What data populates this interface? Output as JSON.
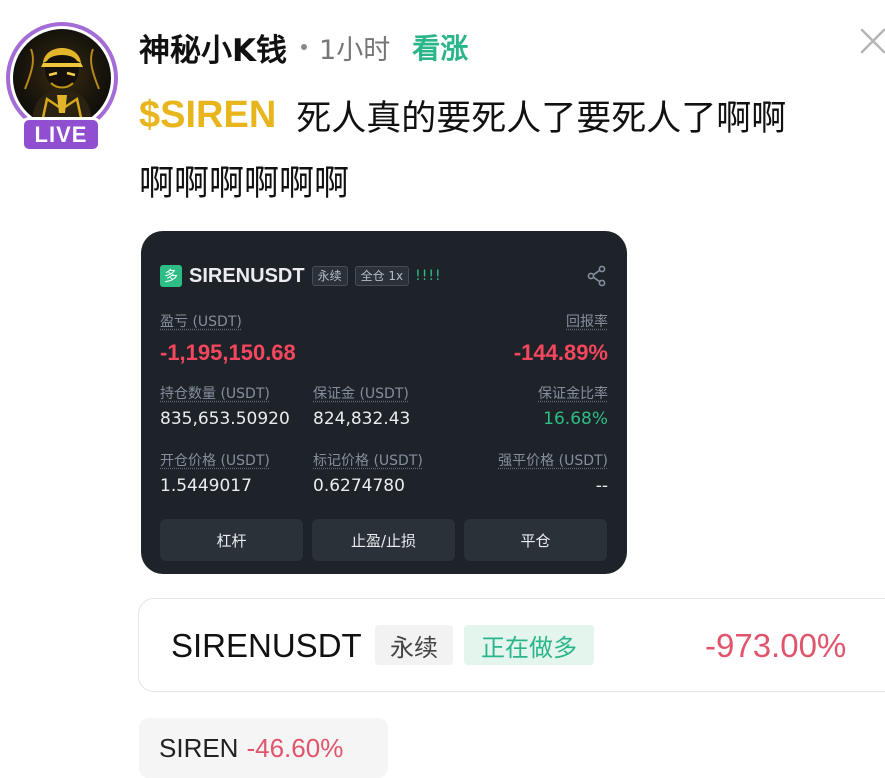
{
  "post": {
    "author": "神秘小K钱",
    "time": "1小时",
    "follow_label": "看涨",
    "live_badge": "LIVE",
    "ticker": "$SIREN",
    "text_line1": "死人真的要死人了要死人了啊啊",
    "text_line2": "啊啊啊啊啊啊"
  },
  "position_card": {
    "side_tag": "多",
    "symbol": "SIRENUSDT",
    "contract_tag": "永续",
    "margin_tag": "全仓 1x",
    "signal_bars": "!!!!",
    "pnl_label": "盈亏 (USDT)",
    "pnl_value": "-1,195,150.68",
    "roe_label": "回报率",
    "roe_value": "-144.89%",
    "size_label": "持仓数量 (USDT)",
    "size_value": "835,653.50920",
    "margin_label": "保证金 (USDT)",
    "margin_value": "824,832.43",
    "margin_ratio_label": "保证金比率",
    "margin_ratio_value": "16.68%",
    "entry_label": "开仓价格 (USDT)",
    "entry_value": "1.5449017",
    "mark_label": "标记价格 (USDT)",
    "mark_value": "0.6274780",
    "liq_label": "强平价格 (USDT)",
    "liq_value": "--",
    "buttons": [
      "杠杆",
      "止盈/止损",
      "平仓"
    ]
  },
  "trade_widget": {
    "symbol": "SIRENUSDT",
    "contract_tag": "永续",
    "direction": "正在做多",
    "pct": "-973.00%"
  },
  "ticker_chip": {
    "symbol": "SIREN",
    "pct": "-46.60%"
  },
  "icons": [
    "close-icon",
    "share-icon",
    "avatar-image"
  ],
  "colors": {
    "ticker": "#e8b51c",
    "follow": "#2bb58a",
    "live": "#8f4fd0",
    "card_bg": "#1e2329",
    "loss": "#f6465d",
    "profit": "#2ebd85",
    "pct_red": "#e0556b"
  }
}
